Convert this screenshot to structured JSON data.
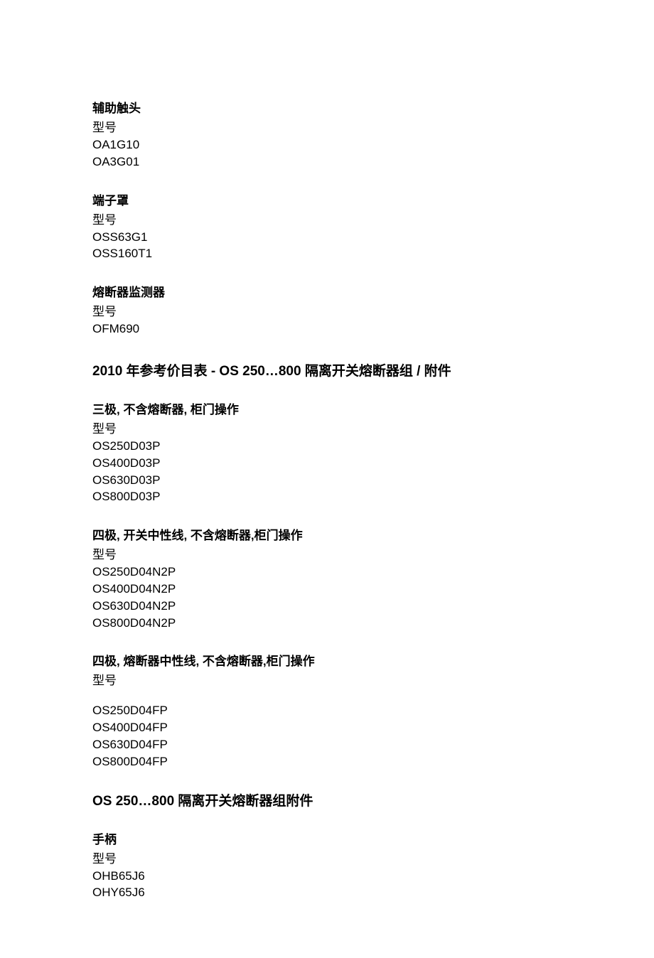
{
  "sections": [
    {
      "head": "辅助触头",
      "label": "型号",
      "items": [
        "OA1G10",
        "OA3G01"
      ]
    },
    {
      "head": "端子罩",
      "label": "型号",
      "items": [
        "OSS63G1",
        "OSS160T1"
      ]
    },
    {
      "head": "熔断器监测器",
      "label": "型号",
      "items": [
        "OFM690"
      ]
    }
  ],
  "main_title": "2010 年参考价目表  - OS 250…800  隔离开关熔断器组  /  附件",
  "groups": [
    {
      "head": "三极, 不含熔断器, 柜门操作",
      "label": "型号",
      "items": [
        "OS250D03P",
        "OS400D03P",
        "OS630D03P",
        "OS800D03P"
      ]
    },
    {
      "head": "四极, 开关中性线, 不含熔断器,柜门操作",
      "label": "型号",
      "items": [
        "OS250D04N2P",
        "OS400D04N2P",
        "OS630D04N2P",
        "OS800D04N2P"
      ]
    },
    {
      "head": "四极, 熔断器中性线, 不含熔断器,柜门操作",
      "label": "型号",
      "gap": true,
      "items": [
        "OS250D04FP",
        "OS400D04FP",
        "OS630D04FP",
        "OS800D04FP"
      ]
    }
  ],
  "sub_title": "OS 250…800  隔离开关熔断器组附件",
  "handle": {
    "head": "手柄",
    "label": "型号",
    "items": [
      "OHB65J6",
      "OHY65J6"
    ]
  }
}
